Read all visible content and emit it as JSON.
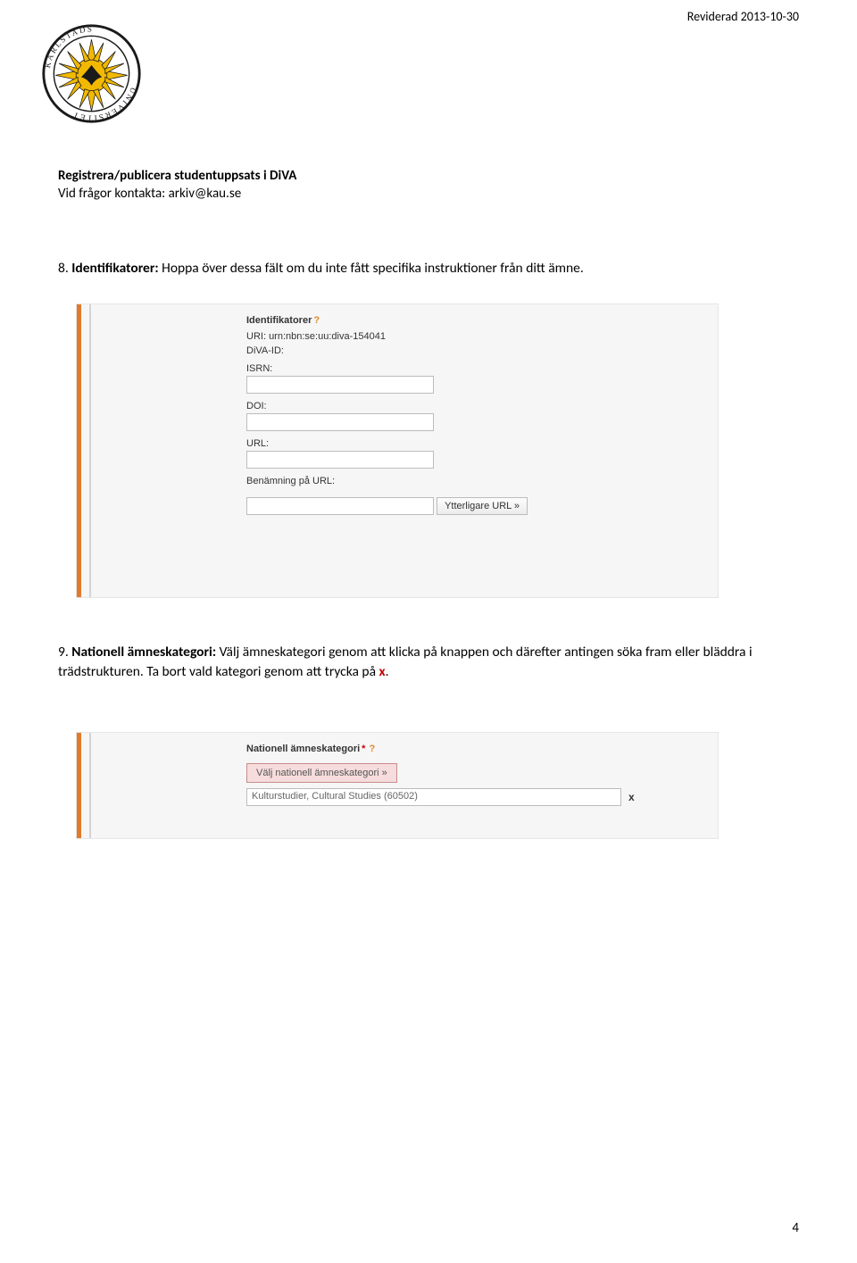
{
  "header": {
    "revised": "Reviderad 2013-10-30"
  },
  "subtitle": {
    "line1": "Registrera/publicera studentuppsats i DiVA",
    "line2": "Vid frågor kontakta: arkiv@kau.se"
  },
  "section8": {
    "num": "8.",
    "label": "Identifikatorer:",
    "text": " Hoppa över dessa fält om du inte fått specifika instruktioner från ditt ämne."
  },
  "section9": {
    "num": "9.",
    "label": "Nationell ämneskategori:",
    "text": " Välj ämneskategori genom att klicka på knappen och därefter antingen söka fram eller bläddra i trädstrukturen. Ta bort vald kategori genom att trycka på ",
    "x": "x",
    "period": "."
  },
  "ss1": {
    "heading": "Identifikatorer",
    "uri_label": "URI:",
    "uri_value": "urn:nbn:se:uu:diva-154041",
    "diva_label": "DiVA-ID:",
    "isrn_label": "ISRN:",
    "doi_label": "DOI:",
    "url_label": "URL:",
    "urlname_label": "Benämning på URL:",
    "more_btn": "Ytterligare URL »"
  },
  "ss2": {
    "heading": "Nationell ämneskategori",
    "choose_btn": "Välj nationell ämneskategori »",
    "category_value": "Kulturstudier, Cultural Studies (60502)",
    "delete_x": "x"
  },
  "page_number": "4"
}
